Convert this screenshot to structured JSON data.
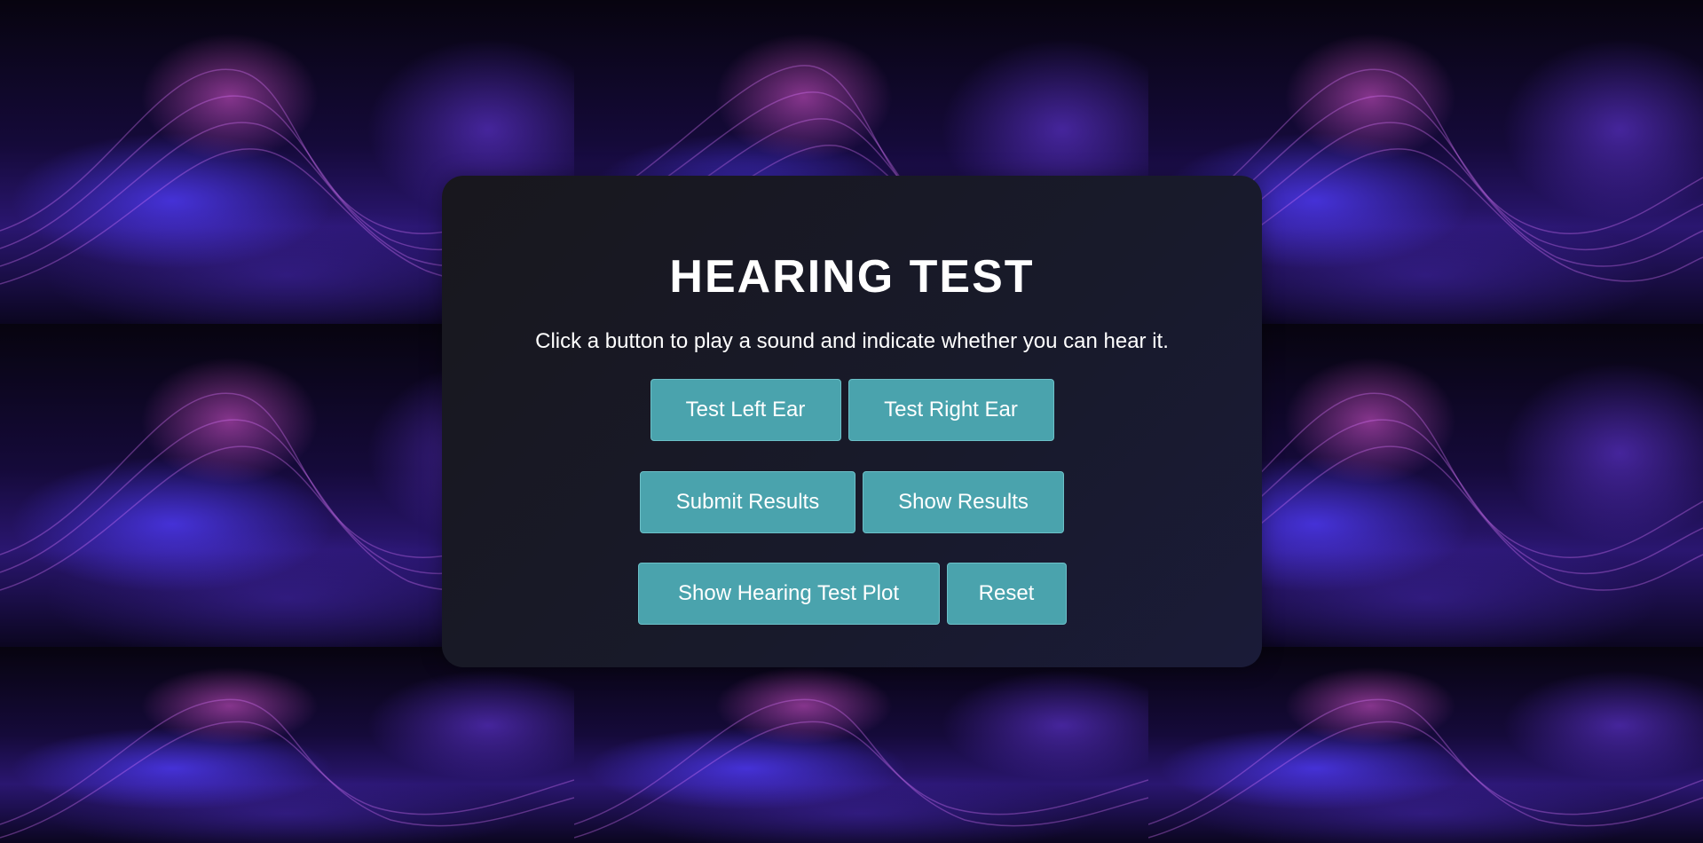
{
  "background": {
    "description_icon": "wave-mesh-tile",
    "accent_colors": [
      "#e05ad8",
      "#4f3cff",
      "#2a1670"
    ]
  },
  "panel": {
    "title": "HEARING TEST",
    "subtitle": "Click a button to play a sound and indicate whether you can hear it.",
    "buttons": {
      "test_left": "Test Left Ear",
      "test_right": "Test Right Ear",
      "submit": "Submit Results",
      "show_results": "Show Results",
      "show_plot": "Show Hearing Test Plot",
      "reset": "Reset"
    },
    "button_color": "#4aa3ad"
  }
}
